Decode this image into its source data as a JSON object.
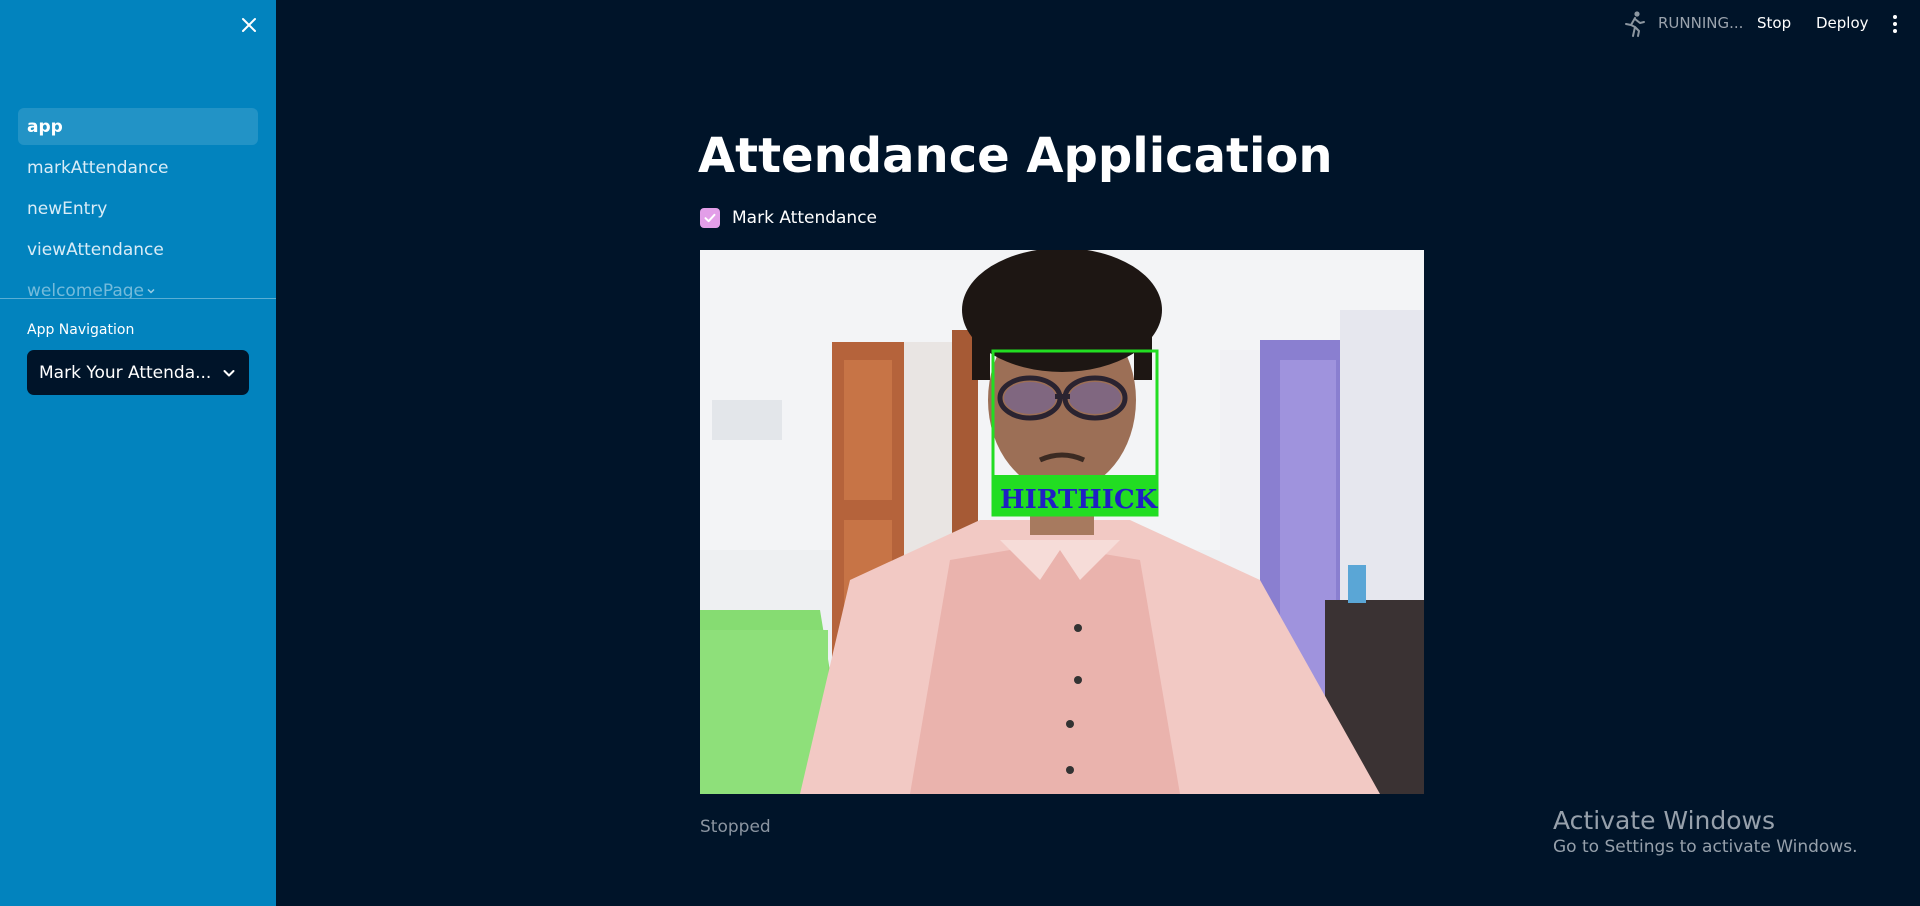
{
  "sidebar": {
    "nav_items": [
      {
        "label": "app",
        "active": true
      },
      {
        "label": "markAttendance"
      },
      {
        "label": "newEntry"
      },
      {
        "label": "viewAttendance"
      },
      {
        "label": "welcomePage"
      }
    ],
    "section_label": "App Navigation",
    "select_value": "Mark Your Attenda..."
  },
  "header": {
    "status": "RUNNING...",
    "stop_label": "Stop",
    "deploy_label": "Deploy"
  },
  "main": {
    "title": "Attendance Application",
    "checkbox_label": "Mark Attendance",
    "checkbox_checked": true,
    "face_label": "HIRTHICK",
    "status_text": "Stopped"
  },
  "watermark": {
    "title": "Activate Windows",
    "subtitle": "Go to Settings to activate Windows."
  },
  "colors": {
    "sidebar": "#0283be",
    "background": "#001429",
    "checkbox": "#e29ee8",
    "face_box": "#22dd22"
  }
}
